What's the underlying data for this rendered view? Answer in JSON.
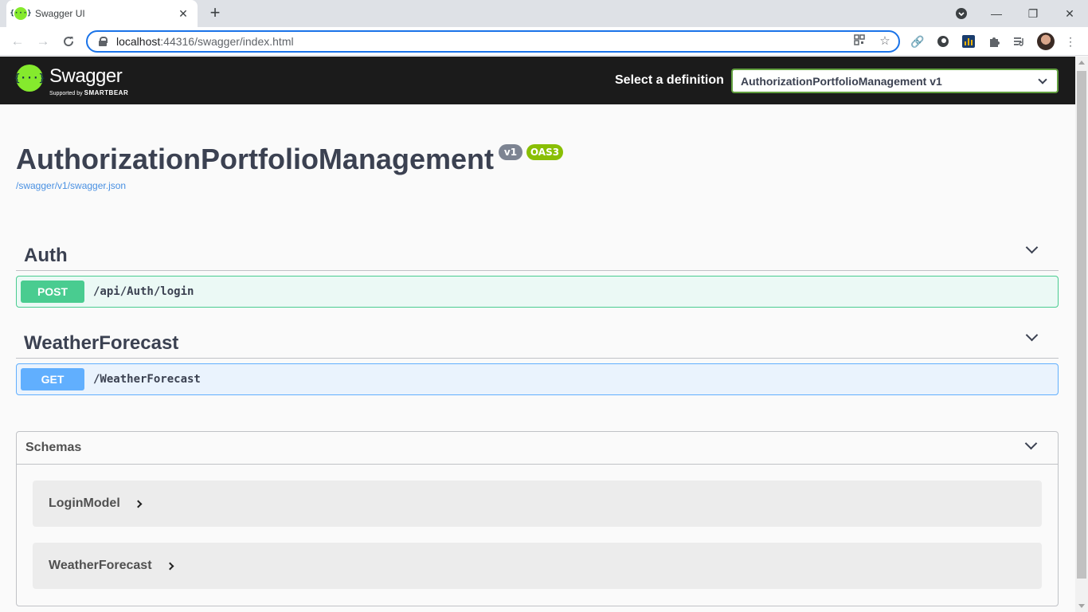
{
  "browser": {
    "tab_title": "Swagger UI",
    "tab_favicon": "{···}",
    "url_host": "localhost",
    "url_rest": ":44316/swagger/index.html",
    "window_controls": {
      "minimize": "—",
      "restore": "❐",
      "close": "✕"
    }
  },
  "swagger": {
    "logo_text": "Swagger",
    "logo_icon": "{···}",
    "logo_sub_prefix": "Supported by",
    "logo_sub_brand": "SMARTBEAR",
    "definition_label": "Select a definition",
    "definition_selected": "AuthorizationPortfolioManagement v1",
    "title": "AuthorizationPortfolioManagement",
    "version_badge": "v1",
    "oas_badge": "OAS3",
    "spec_link": "/swagger/v1/swagger.json",
    "tags": [
      {
        "name": "Auth",
        "operations": [
          {
            "method": "POST",
            "path": "/api/Auth/login"
          }
        ]
      },
      {
        "name": "WeatherForecast",
        "operations": [
          {
            "method": "GET",
            "path": "/WeatherForecast"
          }
        ]
      }
    ],
    "schemas": {
      "title": "Schemas",
      "items": [
        "LoginModel",
        "WeatherForecast"
      ]
    }
  },
  "colors": {
    "post": "#49cc90",
    "get": "#61affe",
    "swagger_green": "#85ea2d",
    "topbar": "#1b1b1b"
  }
}
